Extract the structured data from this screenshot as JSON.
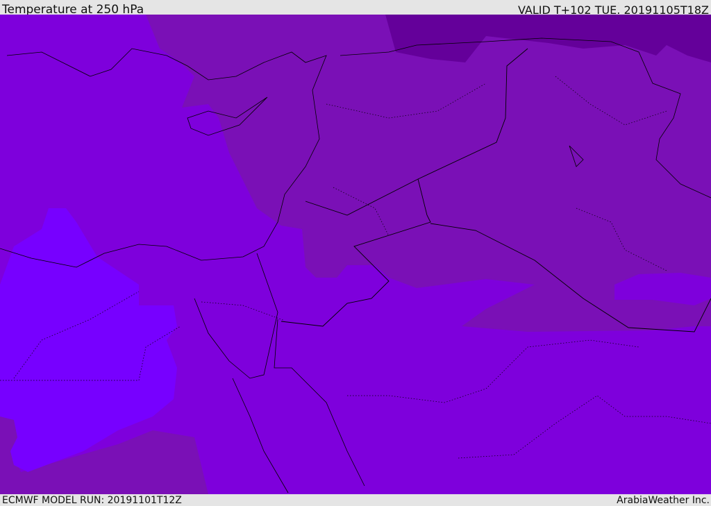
{
  "header": {
    "title": "Temperature at 250 hPa",
    "valid": "VALID T+102 TUE. 20191105T18Z"
  },
  "footer": {
    "model_run": "ECMWF MODEL RUN: 20191101T12Z",
    "credit": "ArabiaWeather Inc."
  },
  "colors": {
    "base": "#7e00dc",
    "light": "#7700ff",
    "mid": "#7a10b6",
    "dark": "#64009a",
    "border": "#000000"
  }
}
